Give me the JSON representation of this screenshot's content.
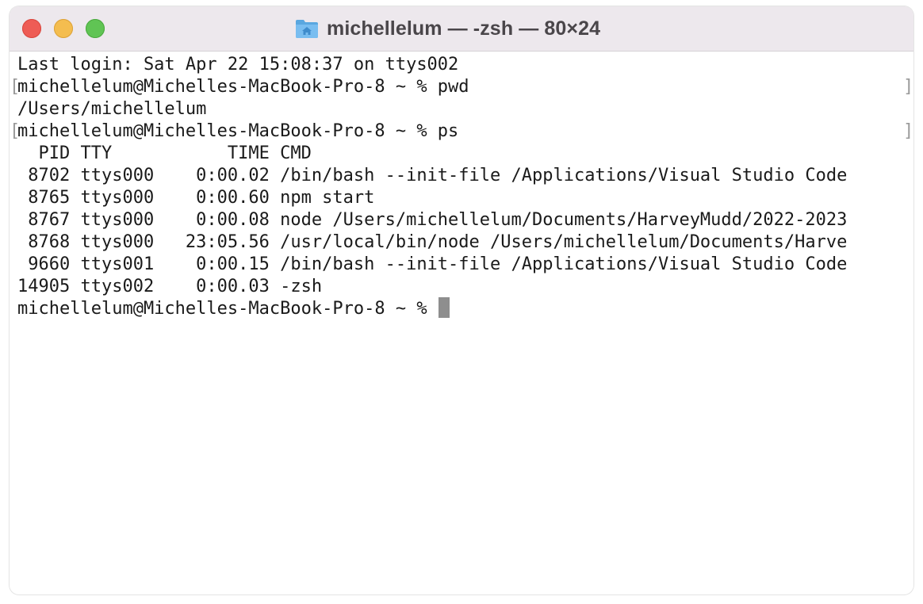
{
  "window": {
    "title": "michellelum — -zsh — 80×24",
    "title_icon": "folder-home-icon",
    "traffic_lights": {
      "close_color": "#ee5c55",
      "minimize_color": "#f4bd4f",
      "zoom_color": "#60c454"
    }
  },
  "terminal": {
    "lines": [
      "Last login: Sat Apr 22 15:08:37 on ttys002",
      "michellelum@Michelles-MacBook-Pro-8 ~ % pwd",
      "/Users/michellelum",
      "michellelum@Michelles-MacBook-Pro-8 ~ % ps",
      "  PID TTY           TIME CMD",
      " 8702 ttys000    0:00.02 /bin/bash --init-file /Applications/Visual Studio Code",
      " 8765 ttys000    0:00.60 npm start",
      " 8767 ttys000    0:00.08 node /Users/michellelum/Documents/HarveyMudd/2022-2023",
      " 8768 ttys000   23:05.56 /usr/local/bin/node /Users/michellelum/Documents/Harve",
      " 9660 ttys001    0:00.15 /bin/bash --init-file /Applications/Visual Studio Code",
      "14905 ttys002    0:00.03 -zsh"
    ],
    "prompt": "michellelum@Michelles-MacBook-Pro-8 ~ % ",
    "mark_left": "[",
    "mark_right": "]"
  }
}
